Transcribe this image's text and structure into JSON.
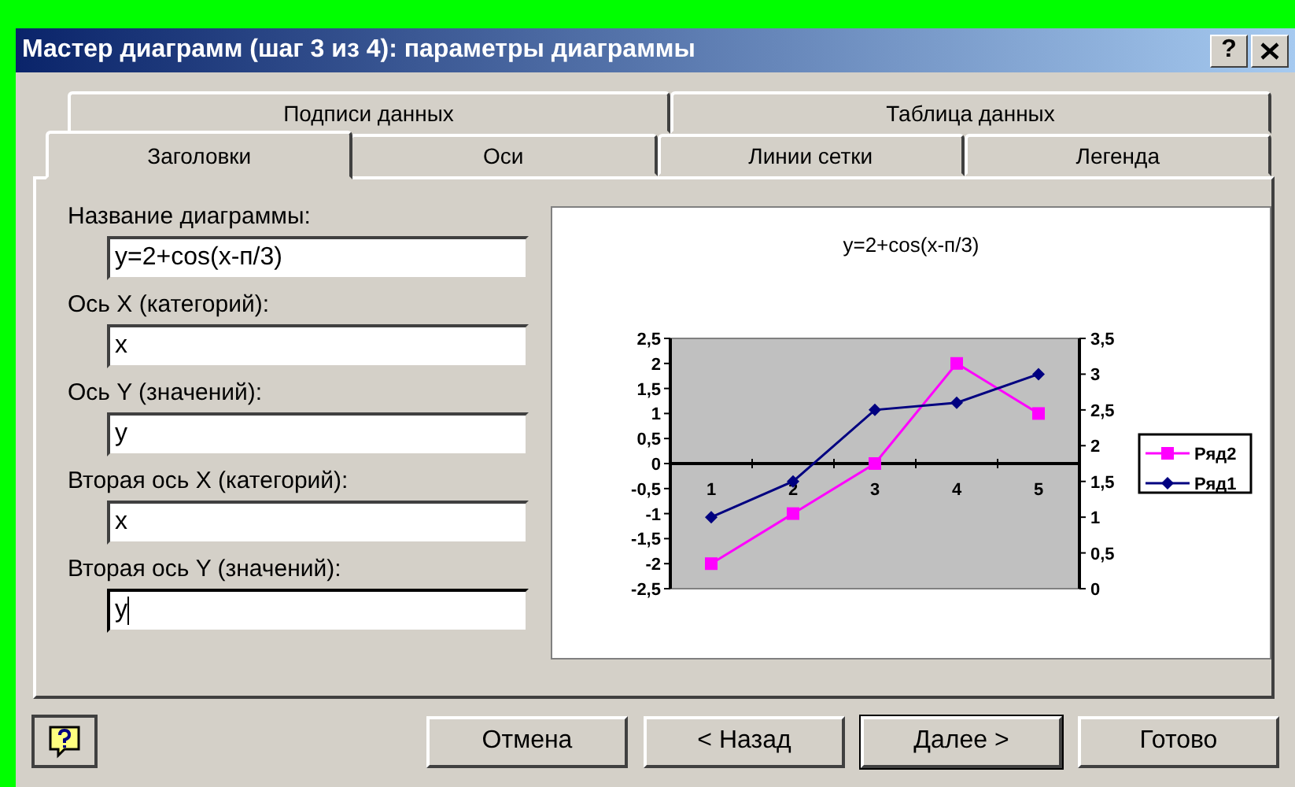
{
  "window": {
    "title": "Мастер диаграмм (шаг 3 из 4): параметры диаграммы",
    "help_button": "?"
  },
  "tab_rows": [
    [
      {
        "label": "Подписи данных",
        "selected": false
      },
      {
        "label": "Таблица данных",
        "selected": false
      }
    ],
    [
      {
        "label": "Заголовки",
        "selected": true
      },
      {
        "label": "Оси",
        "selected": false
      },
      {
        "label": "Линии сетки",
        "selected": false
      },
      {
        "label": "Легенда",
        "selected": false
      }
    ]
  ],
  "fields": [
    {
      "label": "Название диаграммы:",
      "value": "y=2+cos(x-п/3)",
      "focused": false
    },
    {
      "label": "Ось X (категорий):",
      "value": "x",
      "focused": false
    },
    {
      "label": "Ось Y (значений):",
      "value": "y",
      "focused": false
    },
    {
      "label": "Вторая ось X (категорий):",
      "value": "x",
      "focused": false
    },
    {
      "label": "Вторая ось Y (значений):",
      "value": "y",
      "focused": true
    }
  ],
  "preview": {
    "chart_data": {
      "type": "line",
      "title": "y=2+cos(x-п/3)",
      "categories": [
        "1",
        "2",
        "3",
        "4",
        "5"
      ],
      "series": [
        {
          "name": "Ряд2",
          "color": "#ff00ff",
          "marker": "square",
          "values": [
            -2,
            -1,
            0,
            2,
            1
          ]
        },
        {
          "name": "Ряд1",
          "color": "#000080",
          "axis": "y2",
          "marker": "diamond",
          "values": [
            1,
            1.5,
            2.5,
            2.6,
            3
          ]
        }
      ],
      "legend": "right",
      "ylim": [
        -2.5,
        2.5
      ],
      "yticks": [
        {
          "value": 2.5,
          "label": "2,5"
        },
        {
          "value": 2,
          "label": "2"
        },
        {
          "value": 1.5,
          "label": "1,5"
        },
        {
          "value": 1,
          "label": "1"
        },
        {
          "value": 0.5,
          "label": "0,5"
        },
        {
          "value": 0,
          "label": "0"
        },
        {
          "value": -0.5,
          "label": "-0,5"
        },
        {
          "value": -1,
          "label": "-1"
        },
        {
          "value": -1.5,
          "label": "-1,5"
        },
        {
          "value": -2,
          "label": "-2"
        },
        {
          "value": -2.5,
          "label": "-2,5"
        }
      ],
      "y2lim": [
        0,
        3.5
      ],
      "y2ticks": [
        {
          "value": 3.5,
          "label": "3,5"
        },
        {
          "value": 3,
          "label": "3"
        },
        {
          "value": 2.5,
          "label": "2,5"
        },
        {
          "value": 2,
          "label": "2"
        },
        {
          "value": 1.5,
          "label": "1,5"
        },
        {
          "value": 1,
          "label": "1"
        },
        {
          "value": 0.5,
          "label": "0,5"
        },
        {
          "value": 0,
          "label": "0"
        }
      ]
    }
  },
  "buttons": [
    {
      "label": "Отмена",
      "default": false
    },
    {
      "label": "< Назад",
      "default": false
    },
    {
      "label": "Далее >",
      "default": true
    },
    {
      "label": "Готово",
      "default": false
    }
  ]
}
